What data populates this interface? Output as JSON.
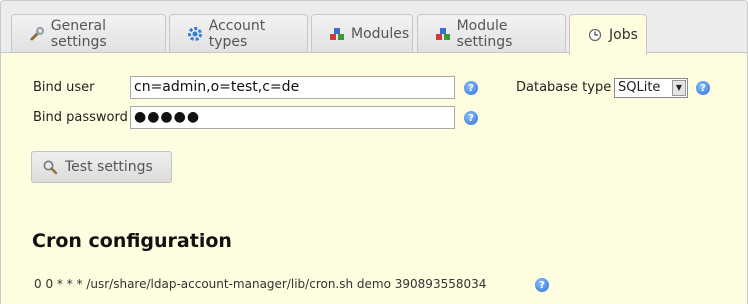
{
  "tabs": [
    {
      "label": "General settings",
      "icon": "wrench-icon"
    },
    {
      "label": "Account types",
      "icon": "gear-icon"
    },
    {
      "label": "Modules",
      "icon": "modules-icon"
    },
    {
      "label": "Module settings",
      "icon": "module-settings-icon"
    },
    {
      "label": "Jobs",
      "icon": "clock-icon"
    }
  ],
  "form": {
    "bind_user_label": "Bind user",
    "bind_user_value": "cn=admin,o=test,c=de",
    "bind_password_label": "Bind password",
    "bind_password_value": "●●●●●",
    "database_type_label": "Database type",
    "database_type_value": "SQLite",
    "test_button_label": "Test settings"
  },
  "cron": {
    "heading": "Cron configuration",
    "command": "0 0 * * * /usr/share/ldap-account-manager/lib/cron.sh demo 390893558034"
  }
}
